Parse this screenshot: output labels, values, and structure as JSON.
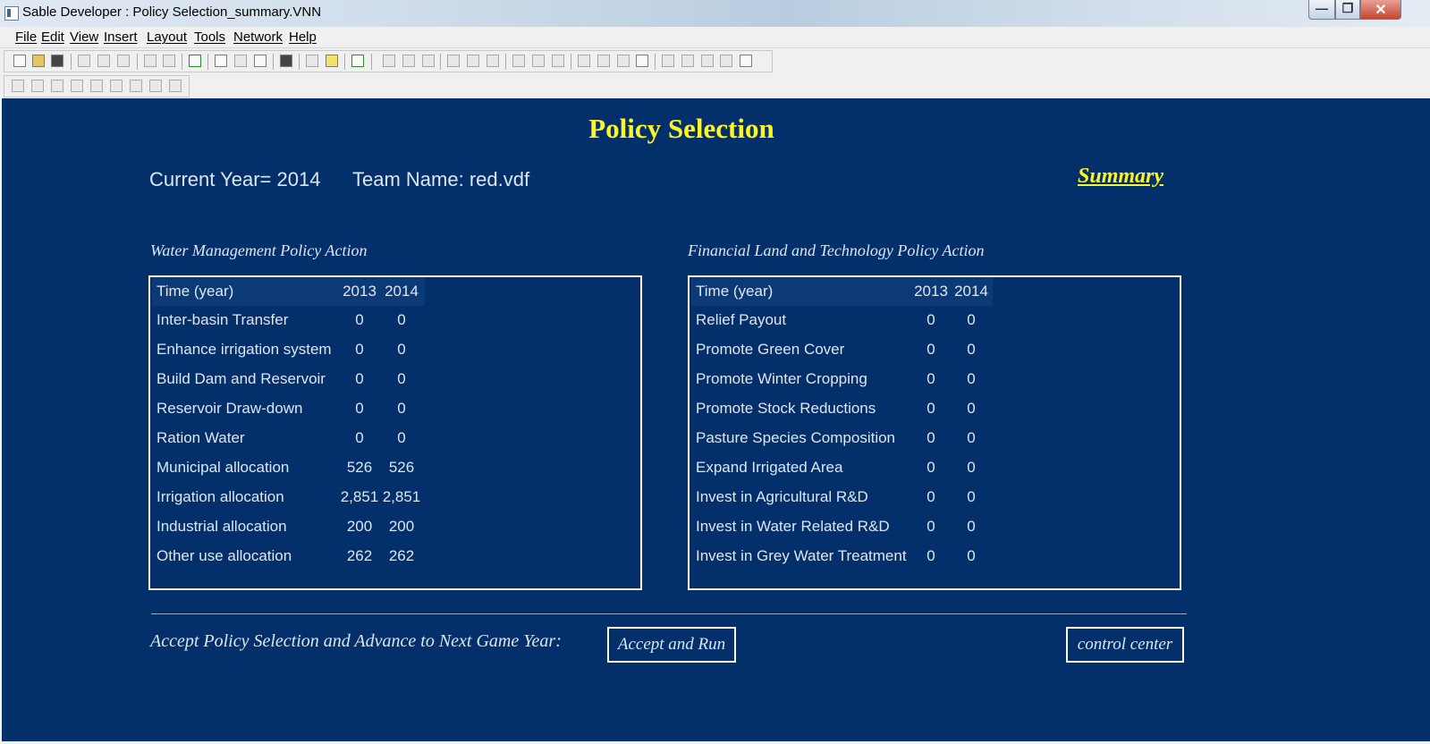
{
  "window": {
    "title": "Sable Developer : Policy Selection_summary.VNN",
    "controls": {
      "minimize_icon": "minimize-icon",
      "maximize_icon": "restore-icon",
      "close_icon": "close-icon"
    }
  },
  "menu": {
    "items": [
      "File",
      "Edit",
      "View",
      "Insert",
      "Layout",
      "Tools",
      "Network",
      "Help"
    ]
  },
  "page": {
    "title": "Policy Selection",
    "current_year": "Current Year= 2014",
    "team_name": "Team Name: red.vdf",
    "summary_link": "Summary",
    "title_color": "#fdf524",
    "background_color": "#03306b"
  },
  "water_table": {
    "title": "Water Management Policy Action",
    "header": {
      "label": "Time (year)",
      "y1": "2013",
      "y2": "2014"
    },
    "rows": [
      {
        "label": "Inter-basin Transfer",
        "v1": "0",
        "v2": "0"
      },
      {
        "label": "Enhance irrigation system",
        "v1": "0",
        "v2": "0"
      },
      {
        "label": "Build Dam and Reservoir",
        "v1": "0",
        "v2": "0"
      },
      {
        "label": "Reservoir Draw-down",
        "v1": "0",
        "v2": "0"
      },
      {
        "label": "Ration Water",
        "v1": "0",
        "v2": "0"
      },
      {
        "label": "Municipal allocation",
        "v1": "526",
        "v2": "526"
      },
      {
        "label": "Irrigation allocation",
        "v1": "2,851",
        "v2": "2,851"
      },
      {
        "label": "Industrial allocation",
        "v1": "200",
        "v2": "200"
      },
      {
        "label": "Other use allocation",
        "v1": "262",
        "v2": "262"
      }
    ]
  },
  "finance_table": {
    "title": "Financial Land and Technology Policy Action",
    "header": {
      "label": "Time (year)",
      "y1": "2013",
      "y2": "2014"
    },
    "rows": [
      {
        "label": "Relief Payout",
        "v1": "0",
        "v2": "0"
      },
      {
        "label": "Promote Green Cover",
        "v1": "0",
        "v2": "0"
      },
      {
        "label": "Promote Winter Cropping",
        "v1": "0",
        "v2": "0"
      },
      {
        "label": "Promote Stock Reductions",
        "v1": "0",
        "v2": "0"
      },
      {
        "label": "Pasture Species Composition",
        "v1": "0",
        "v2": "0"
      },
      {
        "label": "Expand Irrigated Area",
        "v1": "0",
        "v2": "0"
      },
      {
        "label": "Invest in Agricultural R&D",
        "v1": "0",
        "v2": "0"
      },
      {
        "label": "Invest in Water Related R&D",
        "v1": "0",
        "v2": "0"
      },
      {
        "label": "Invest in Grey Water Treatment",
        "v1": "0",
        "v2": "0"
      }
    ]
  },
  "footer": {
    "accept_label": "Accept Policy Selection and Advance to Next Game Year:",
    "accept_button": "Accept and Run",
    "control_button": "control center"
  }
}
